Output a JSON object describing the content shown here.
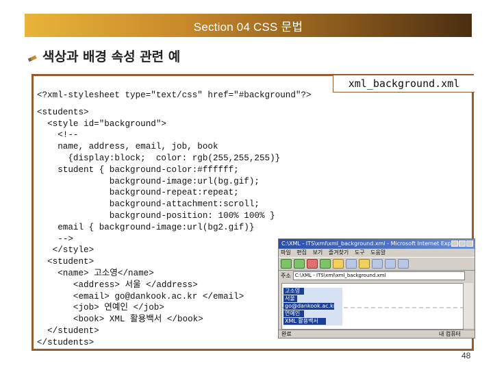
{
  "slide": {
    "section_title": "Section 04 CSS 문법",
    "heading": "색상과 배경 속성 관련 예",
    "file_label": "xml_background.xml",
    "page_number": "48",
    "colors": {
      "banner_left": "#e8b43a",
      "banner_right": "#4a2e10",
      "panel_border": "#9b5a2a"
    }
  },
  "code_lines": [
    "<?xml-stylesheet type=\"text/css\" href=\"#background\"?>",
    "",
    "<students>",
    "  <style id=\"background\">",
    "    <!--",
    "    name, address, email, job, book",
    "      {display:block;  color: rgb(255,255,255)}",
    "    student { background-color:#ffffff;",
    "              background-image:url(bg.gif);",
    "              background-repeat:repeat;",
    "              background-attachment:scroll;",
    "              background-position: 100% 100% }",
    "    email { background-image:url(bg2.gif)}",
    "    -->",
    "   </style>",
    "  <student>",
    "    <name> 고소영</name>",
    "       <address> 서울 </address>",
    "       <email> go@dankook.ac.kr </email>",
    "       <job> 연예인 </job>",
    "       <book> XML 활용백서 </book>",
    "  </student>",
    "</students>"
  ],
  "browser": {
    "title": "C:\\XML - ITS\\xml\\xml_background.xml - Microsoft Internet Explorer",
    "menu": [
      "파일",
      "편집",
      "보기",
      "즐겨찾기",
      "도구",
      "도움말"
    ],
    "address_label": "주소",
    "address": "C:\\XML - ITS\\xml\\xml_background.xml",
    "records": [
      "고소영",
      "서울",
      "go@dankook.ac.kr",
      "연예인",
      "XML 활용백서"
    ],
    "status_left": "완료",
    "status_right": "내 컴퓨터",
    "toolbar_icons": [
      "back-icon",
      "forward-icon",
      "stop-icon",
      "refresh-icon",
      "home-icon",
      "search-icon",
      "favorites-icon",
      "history-icon",
      "mail-icon",
      "print-icon"
    ]
  }
}
